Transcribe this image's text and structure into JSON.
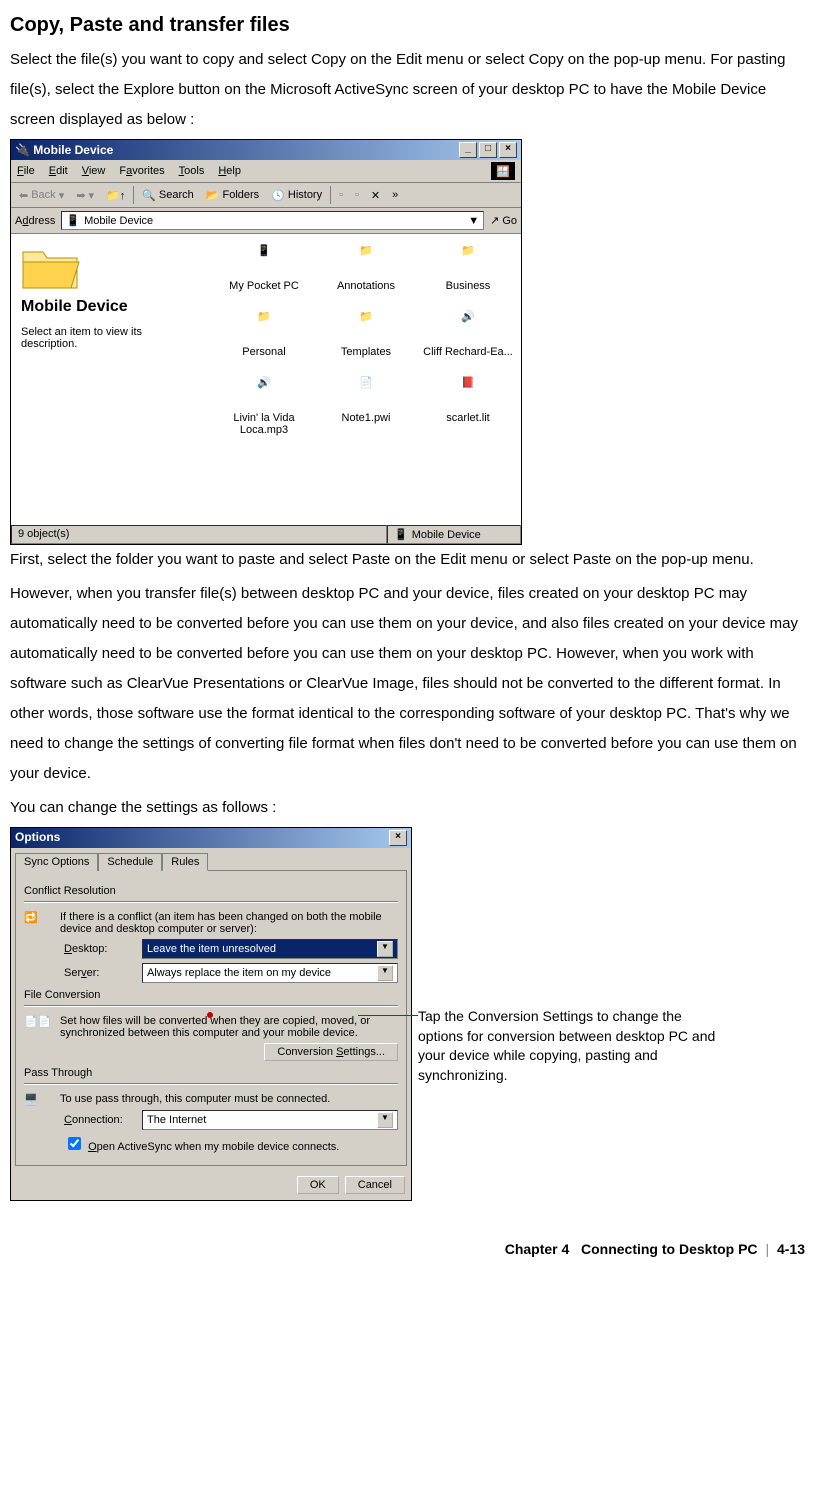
{
  "heading": "Copy, Paste and transfer files",
  "para1": "Select the file(s) you want to copy and select Copy on the Edit menu or select Copy on the pop-up menu. For pasting file(s), select the Explore button on the Microsoft ActiveSync screen of your desktop PC to have the Mobile Device screen displayed as below :",
  "explorer": {
    "title": "Mobile Device",
    "menus": [
      "File",
      "Edit",
      "View",
      "Favorites",
      "Tools",
      "Help"
    ],
    "toolbar": {
      "back": "Back",
      "search": "Search",
      "folders": "Folders",
      "history": "History"
    },
    "address_label": "Address",
    "address_value": "Mobile Device",
    "go": "Go",
    "side_title": "Mobile Device",
    "side_text": "Select an item to view its description.",
    "icons": [
      "My Pocket PC",
      "Annotations",
      "Business",
      "Personal",
      "Templates",
      "Cliff Rechard-Ea...",
      "Livin' la Vida Loca.mp3",
      "Note1.pwi",
      "scarlet.lit"
    ],
    "status_left": "9 object(s)",
    "status_right": "Mobile Device"
  },
  "para2": "First, select the folder you want to paste and select Paste on the Edit menu or select Paste on the pop-up menu.",
  "para3": "However, when you transfer file(s) between desktop PC and your device, files created on your desktop PC may automatically need to be converted before you can use them on your device, and also files created on your device may automatically need to be converted before you can use them on your desktop PC. However, when you work with software such as ClearVue Presentations or ClearVue Image, files should not be converted to the different format. In other words, those software use the format identical to the corresponding software of your desktop PC. That's why we need to change the settings of converting file format when files don't need to be converted before you can use them on your device.",
  "para4": "You can change the settings as follows :",
  "options": {
    "title": "Options",
    "tabs": [
      "Sync Options",
      "Schedule",
      "Rules"
    ],
    "active_tab": 2,
    "conflict_label": "Conflict Resolution",
    "conflict_text": "If there is a conflict (an item has been changed on both the mobile device and desktop computer or server):",
    "desktop_label": "Desktop:",
    "desktop_value": "Leave the item unresolved",
    "server_label": "Server:",
    "server_value": "Always replace the item on my device",
    "fileconv_label": "File Conversion",
    "fileconv_text": "Set how files will be converted when they are copied, moved, or synchronized between this computer and your mobile device.",
    "conv_button": "Conversion Settings...",
    "passthrough_label": "Pass Through",
    "passthrough_text": "To use pass through, this computer must be connected.",
    "connection_label": "Connection:",
    "connection_value": "The Internet",
    "open_check": "Open ActiveSync when my mobile device connects.",
    "ok": "OK",
    "cancel": "Cancel"
  },
  "callout": "Tap the Conversion Settings to change the options for conversion between desktop PC and your device while copying, pasting and synchronizing.",
  "footer_chapter": "Chapter 4",
  "footer_title": "Connecting to Desktop PC",
  "footer_page": "4-13"
}
